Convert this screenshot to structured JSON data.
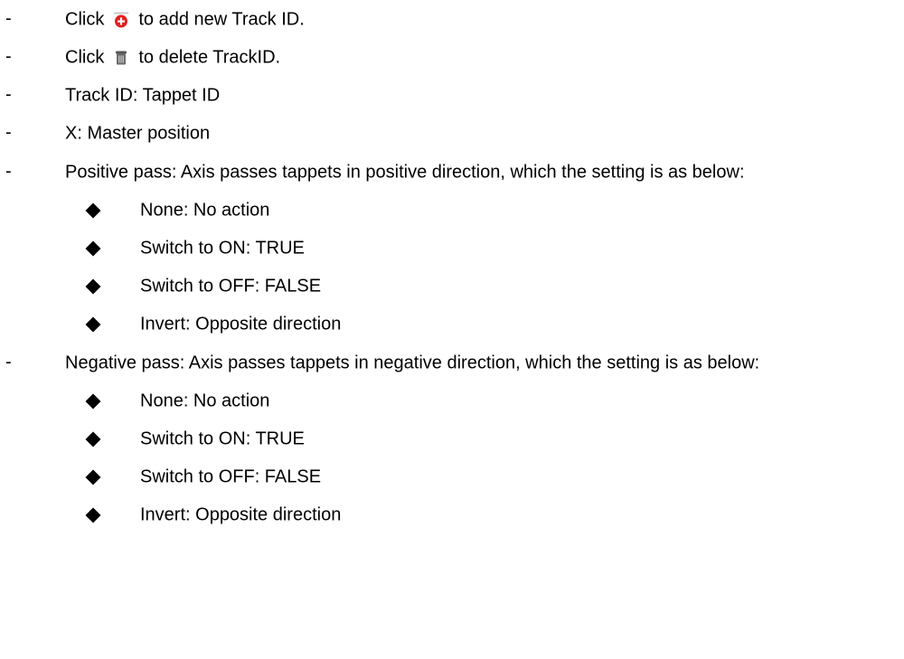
{
  "lines": [
    {
      "bullet": "-",
      "before": "Click",
      "icon": "add-icon",
      "after": "to add new Track ID."
    },
    {
      "bullet": "-",
      "before": "Click",
      "icon": "delete-icon",
      "after": "to delete TrackID."
    },
    {
      "bullet": "-",
      "text": "Track ID: Tappet ID"
    },
    {
      "bullet": "-",
      "text": "X: Master position"
    },
    {
      "bullet": "-",
      "text": "Positive pass: Axis passes tappets in positive direction, which the setting is as below:"
    }
  ],
  "positive_options": [
    "None: No action",
    "Switch to ON: TRUE",
    "Switch to OFF: FALSE",
    "Invert: Opposite direction"
  ],
  "negative_line": {
    "bullet": "-",
    "text": "Negative pass: Axis passes tappets in negative direction, which the setting is as below:"
  },
  "negative_options": [
    "None: No action",
    "Switch to ON: TRUE",
    "Switch to OFF: FALSE",
    "Invert: Opposite direction"
  ],
  "colors": {
    "add_icon": "#e02020",
    "delete_icon": "#6b6b6b"
  }
}
